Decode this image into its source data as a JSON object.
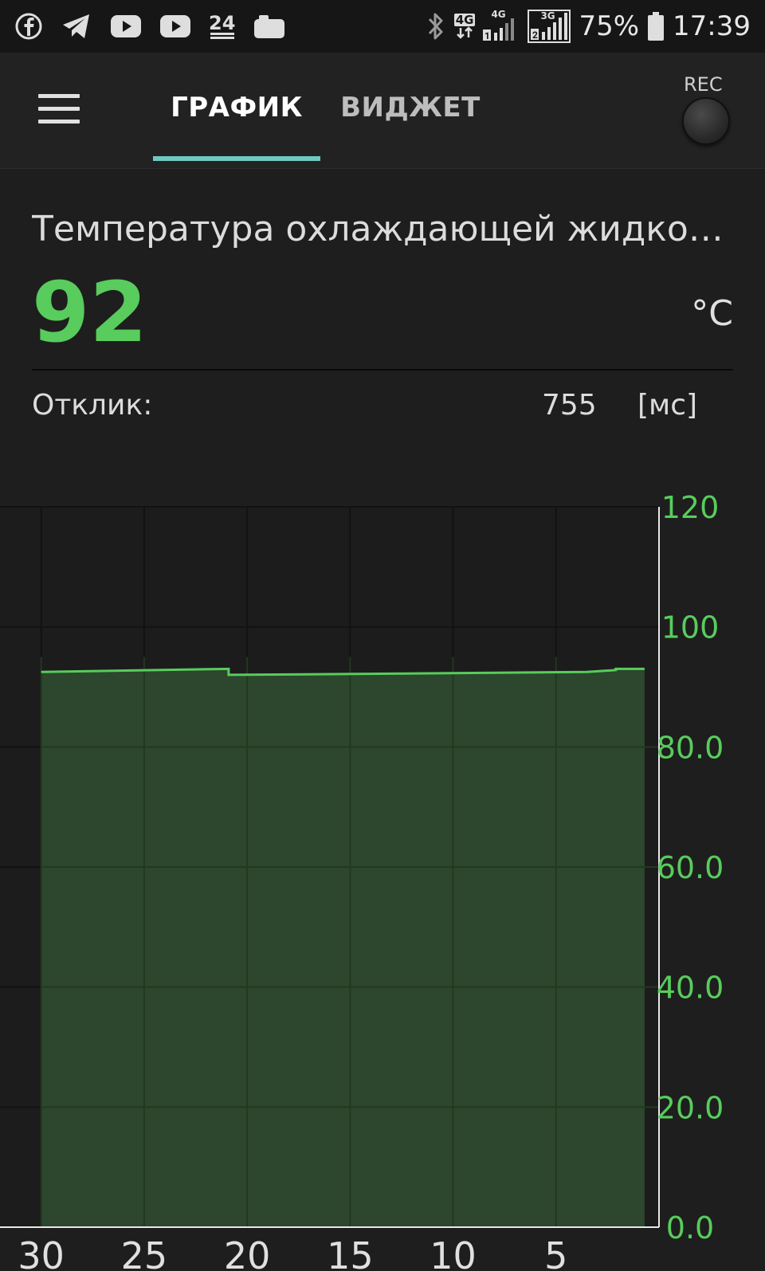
{
  "status_bar": {
    "left_icons": [
      "facebook-icon",
      "telegram-icon",
      "youtube-icon",
      "youtube-icon",
      "news24-icon",
      "camera-icon"
    ],
    "news_label": "24",
    "network_labels": [
      "4G",
      "4G",
      "3G"
    ],
    "battery": "75%",
    "time": "17:39"
  },
  "app_bar": {
    "tabs": [
      {
        "label": "ГРАФИК",
        "active": true
      },
      {
        "label": "ВИДЖЕТ",
        "active": false
      }
    ],
    "rec_label": "REC"
  },
  "sensor": {
    "name": "Температура охлаждающей жидко…",
    "value": "92",
    "unit": "°C",
    "response_label": "Отклик:",
    "response_value": "755",
    "response_unit": "[мс]"
  },
  "colors": {
    "accent_green": "#58cc5c",
    "tab_indicator": "#6fc9bf",
    "area_fill": "#2d4a2e"
  },
  "chart_data": {
    "type": "area",
    "x_ticks": [
      30,
      25,
      20,
      15,
      10,
      5
    ],
    "x_tick_labels": [
      "30",
      "25",
      "20",
      "15",
      "10",
      "5"
    ],
    "xlim": [
      32,
      0
    ],
    "y_ticks": [
      0,
      20,
      40,
      60,
      80,
      100,
      120
    ],
    "y_tick_labels": [
      "0.0",
      "20.0",
      "40.0",
      "60.0",
      "80.0",
      "100",
      "120"
    ],
    "ylim": [
      0,
      120
    ],
    "grid": true,
    "y_axis_side": "right",
    "x": [
      30,
      20.9,
      20.9,
      13,
      3.5,
      3.5,
      2.1,
      2.1,
      0.7
    ],
    "y": [
      92.5,
      93,
      92,
      92.2,
      92.5,
      92.5,
      92.8,
      93,
      93
    ]
  }
}
